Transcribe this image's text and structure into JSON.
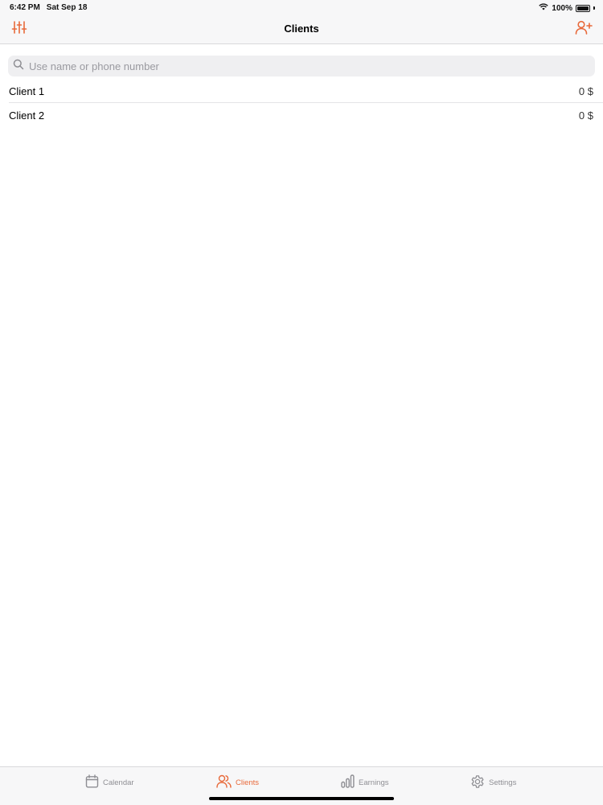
{
  "status_bar": {
    "time": "6:42 PM",
    "date": "Sat Sep 18",
    "battery": "100%"
  },
  "nav": {
    "title": "Clients",
    "left_icon": "filter-sliders-icon",
    "right_icon": "add-user-icon"
  },
  "search": {
    "placeholder": "Use name or phone number",
    "value": ""
  },
  "clients": [
    {
      "name": "Client 1",
      "amount": "0 $"
    },
    {
      "name": "Client 2",
      "amount": "0 $"
    }
  ],
  "tabs": [
    {
      "label": "Calendar",
      "icon": "calendar-icon",
      "active": false
    },
    {
      "label": "Clients",
      "icon": "users-icon",
      "active": true
    },
    {
      "label": "Earnings",
      "icon": "bar-chart-icon",
      "active": false
    },
    {
      "label": "Settings",
      "icon": "gear-icon",
      "active": false
    }
  ],
  "colors": {
    "accent": "#e8693a",
    "inactive": "#8e8e93"
  }
}
